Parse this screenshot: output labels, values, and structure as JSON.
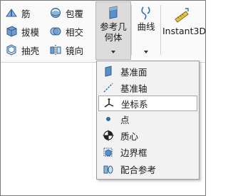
{
  "ribbon": {
    "left_tools": [
      {
        "label": "筋",
        "icon": "rib-icon"
      },
      {
        "label": "拔模",
        "icon": "draft-icon"
      },
      {
        "label": "抽壳",
        "icon": "shell-icon"
      }
    ],
    "mid_tools": [
      {
        "label": "包覆",
        "icon": "wrap-icon"
      },
      {
        "label": "相交",
        "icon": "intersect-icon"
      },
      {
        "label": "镜向",
        "icon": "mirror-icon"
      }
    ],
    "reference_geometry": {
      "line1": "参考几",
      "line2": "何体"
    },
    "curves": {
      "label": "曲线"
    },
    "instant3d": {
      "label": "Instant3D"
    }
  },
  "menu": {
    "items": [
      {
        "label": "基准面",
        "icon": "plane-icon"
      },
      {
        "label": "基准轴",
        "icon": "axis-icon"
      },
      {
        "label": "坐标系",
        "icon": "coordinate-system-icon"
      },
      {
        "label": "点",
        "icon": "point-icon"
      },
      {
        "label": "质心",
        "icon": "center-of-mass-icon"
      },
      {
        "label": "边界框",
        "icon": "bounding-box-icon"
      },
      {
        "label": "配合参考",
        "icon": "mate-reference-icon"
      }
    ],
    "highlighted_index": 2
  },
  "colors": {
    "accent_blue": "#2f6db5",
    "active_button_bg": "#dcdcdc",
    "menu_bg": "#f2f2f2"
  }
}
